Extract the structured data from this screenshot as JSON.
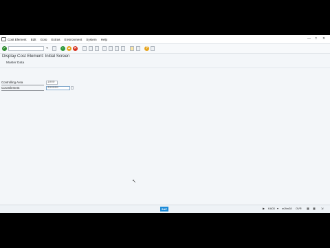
{
  "menu": {
    "items": [
      "Cost Element",
      "Edit",
      "Goto",
      "Extras",
      "Environment",
      "System",
      "Help"
    ]
  },
  "toolbar": {
    "command_value": "",
    "icons": [
      "enter-icon",
      "save-icon",
      "back-icon",
      "exit-icon",
      "cancel-icon",
      "print-icon",
      "find-icon",
      "find-next-icon",
      "first-page-icon",
      "previous-page-icon",
      "next-page-icon",
      "last-page-icon",
      "create-session-icon",
      "shortcut-icon",
      "help-icon",
      "layout-menu-icon"
    ]
  },
  "screen": {
    "title": "Display Cost Element: Initial Screen",
    "tab_label": "Master Data"
  },
  "form": {
    "controlling_area_label": "Controlling Area",
    "controlling_area_value": "1000",
    "cost_element_label": "Cost Element",
    "cost_element_value": "400000"
  },
  "status": {
    "transaction": "KA03",
    "server": "m2tm28",
    "mode": "OVR"
  },
  "colors": {
    "enter_green": "#2e8b2e",
    "back_green": "#2f9a3c",
    "exit_yellow": "#e6a520",
    "cancel_red": "#d6321f",
    "sap_blue": "#1b8ad8"
  }
}
